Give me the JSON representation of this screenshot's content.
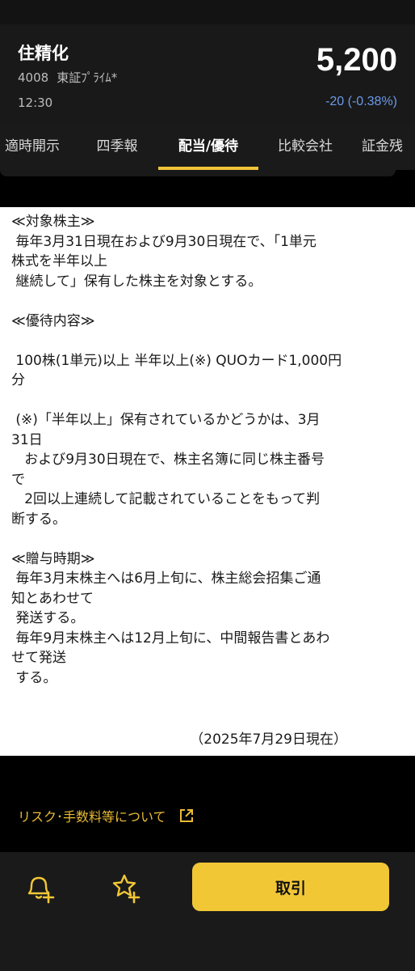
{
  "header": {
    "stock_name": "住精化",
    "code": "4008",
    "market": "東証ﾌﾟﾗｲﾑ*",
    "time": "12:30",
    "price": "5,200",
    "change": "-20 (-0.38%)"
  },
  "tabs": [
    {
      "label": "適時開示"
    },
    {
      "label": "四季報"
    },
    {
      "label": "配当/優待",
      "active": true
    },
    {
      "label": "比較会社"
    },
    {
      "label": "証金残"
    }
  ],
  "content": {
    "body_text": "≪対象株主≫\n 毎年3月31日現在および9月30日現在で、「1単元\n株式を半年以上\n 継続して」保有した株主を対象とする。\n\n≪優待内容≫\n\n 100株(1単元)以上 半年以上(※) QUOカード1,000円\n分\n\n (※)「半年以上」保有されているかどうかは、3月\n31日\n   および9月30日現在で、株主名簿に同じ株主番号\nで\n   2回以上連続して記載されていることをもって判\n断する。\n\n≪贈与時期≫\n 毎年3月末株主へは6月上旬に、株主総会招集ご通\n知とあわせて\n 発送する。\n 毎年9月末株主へは12月上旬に、中間報告書とあわ\nせて発送\n する。",
    "as_of": "（2025年7月29日現在）"
  },
  "footer": {
    "risk_link": "リスク･手数料等について",
    "trade_button": "取引"
  },
  "colors": {
    "accent": "#f2c736",
    "change_blue": "#6b9ae8",
    "header_bg": "#191919"
  }
}
